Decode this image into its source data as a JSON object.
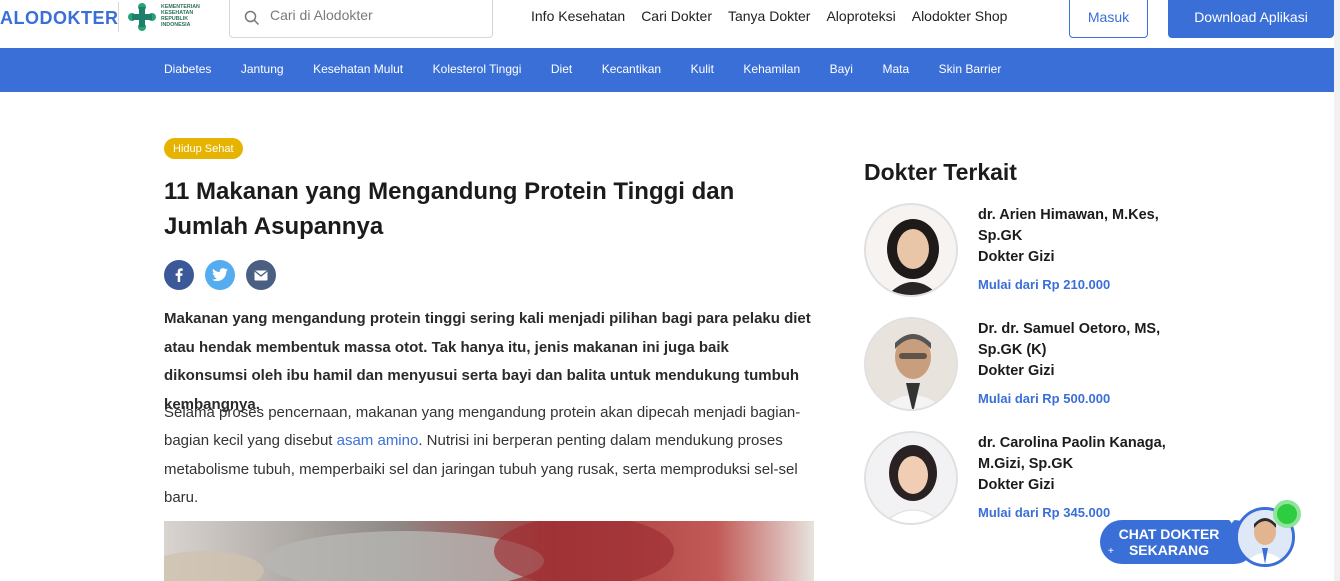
{
  "header": {
    "logo_text": "ALODOKTER",
    "partner_text": "KEMENTERIAN KESEHATAN REPUBLIK INDONESIA",
    "search_placeholder": "Cari di Alodokter",
    "nav": [
      "Info Kesehatan",
      "Cari Dokter",
      "Tanya Dokter",
      "Aloproteksi",
      "Alodokter Shop"
    ],
    "login_label": "Masuk",
    "download_label": "Download Aplikasi"
  },
  "categories": [
    "Diabetes",
    "Jantung",
    "Kesehatan Mulut",
    "Kolesterol Tinggi",
    "Diet",
    "Kecantikan",
    "Kulit",
    "Kehamilan",
    "Bayi",
    "Mata",
    "Skin Barrier"
  ],
  "article": {
    "tag": "Hidup Sehat",
    "title": "11 Makanan yang Mengandung Protein Tinggi dan Jumlah Asupannya",
    "lead": "Makanan yang mengandung protein tinggi sering kali menjadi pilihan bagi para pelaku diet atau hendak membentuk massa otot. Tak hanya itu, jenis makanan ini juga baik dikonsumsi oleh ibu hamil dan menyusui serta bayi dan balita untuk mendukung tumbuh kembangnya.",
    "para_before_link": "Selama proses pencernaan, makanan yang mengandung protein akan dipecah menjadi bagian-bagian kecil yang disebut ",
    "para_link": "asam amino",
    "para_after_link": ". Nutrisi ini berperan penting dalam mendukung proses metabolisme tubuh, memperbaiki sel dan jaringan tubuh yang rusak, serta memproduksi sel-sel baru."
  },
  "sidebar": {
    "title": "Dokter Terkait",
    "doctors": [
      {
        "name": "dr. Arien Himawan, M.Kes, Sp.GK",
        "specialty": "Dokter Gizi",
        "price": "Mulai dari Rp 210.000"
      },
      {
        "name": "Dr. dr. Samuel Oetoro, MS, Sp.GK (K)",
        "specialty": "Dokter Gizi",
        "price": "Mulai dari Rp 500.000"
      },
      {
        "name": "dr. Carolina Paolin Kanaga, M.Gizi, Sp.GK",
        "specialty": "Dokter Gizi",
        "price": "Mulai dari Rp 345.000"
      }
    ]
  },
  "chat": {
    "line1": "CHAT DOKTER",
    "line2": "SEKARANG"
  },
  "colors": {
    "brand": "#3a6fd8",
    "tag": "#e6b400",
    "online": "#2ecc40"
  }
}
